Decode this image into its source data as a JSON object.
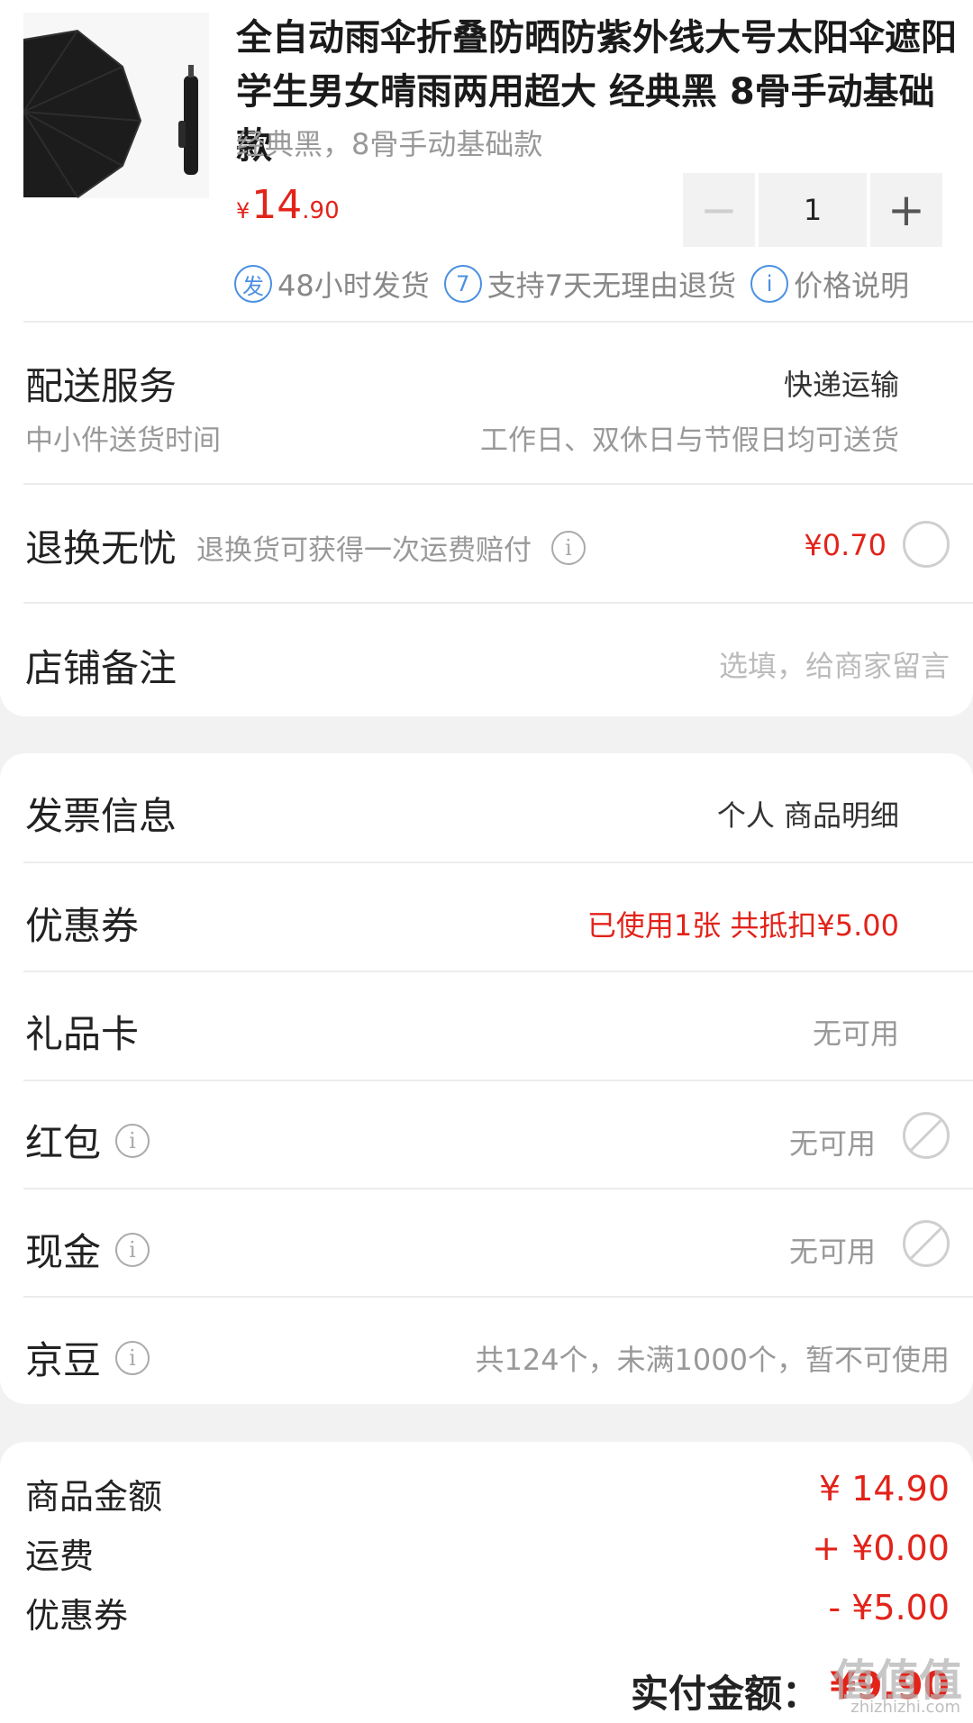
{
  "product": {
    "title": "全自动雨伞折叠防晒防紫外线大号太阳伞遮阳学生男女晴雨两用超大 经典黑 8骨手动基础款",
    "spec": "经典黑，8骨手动基础款",
    "price_symbol": "¥",
    "price_int": "14",
    "price_dec": ".90",
    "quantity": "1",
    "minus": "−",
    "plus": "+",
    "services": [
      {
        "icon": "发",
        "label": "48小时发货"
      },
      {
        "icon": "7",
        "label": "支持7天无理由退货"
      },
      {
        "icon": "i",
        "label": "价格说明"
      }
    ]
  },
  "delivery": {
    "title": "配送服务",
    "value": "快递运输",
    "sub_label": "中小件送货时间",
    "sub_value": "工作日、双休日与节假日均可送货"
  },
  "return": {
    "title": "退换无忧",
    "desc": "退换货可获得一次运费赔付",
    "price": "¥0.70"
  },
  "note": {
    "title": "店铺备注",
    "placeholder": "选填，给商家留言"
  },
  "invoice": {
    "title": "发票信息",
    "value": "个人 商品明细"
  },
  "coupon": {
    "title": "优惠券",
    "value": "已使用1张 共抵扣¥5.00"
  },
  "giftcard": {
    "title": "礼品卡",
    "value": "无可用"
  },
  "redpacket": {
    "title": "红包",
    "value": "无可用"
  },
  "cash": {
    "title": "现金",
    "value": "无可用"
  },
  "jingdou": {
    "title": "京豆",
    "value": "共124个，未满1000个，暂不可使用"
  },
  "summary": {
    "goods_label": "商品金额",
    "goods_value": "¥ 14.90",
    "shipping_label": "运费",
    "shipping_value": "+ ¥0.00",
    "coupon_label": "优惠券",
    "coupon_value": "- ¥5.00",
    "total_label": "实付金额：",
    "total_value": "¥9.90"
  },
  "watermark": {
    "text": "值值值",
    "sub": "zhizhizhi.com"
  },
  "colors": {
    "price_red": "#e2231a",
    "service_blue": "#4a90e2"
  }
}
